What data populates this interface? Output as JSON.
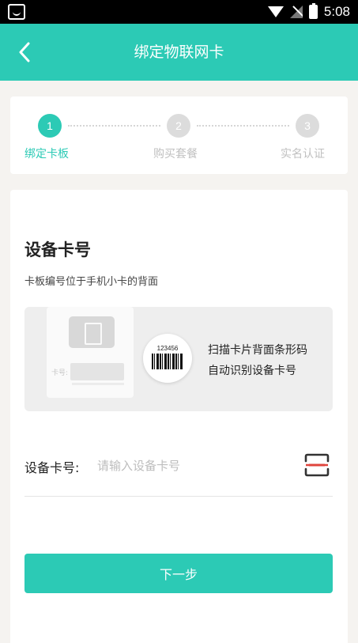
{
  "status_bar": {
    "time": "5:08"
  },
  "nav": {
    "title": "绑定物联网卡"
  },
  "steps": [
    {
      "number": "1",
      "label": "绑定卡板",
      "state": "active"
    },
    {
      "number": "2",
      "label": "购买套餐",
      "state": "inactive"
    },
    {
      "number": "3",
      "label": "实名认证",
      "state": "inactive"
    }
  ],
  "card_section": {
    "title": "设备卡号",
    "description": "卡板编号位于手机小卡的背面",
    "banner": {
      "sim_label": "卡号:",
      "barcode_number": "123456",
      "hint_line1": "扫描卡片背面条形码",
      "hint_line2": "自动识别设备卡号"
    },
    "input": {
      "label": "设备卡号:",
      "placeholder": "请输入设备卡号",
      "value": ""
    }
  },
  "next_button": {
    "label": "下一步"
  },
  "colors": {
    "accent": "#2ccab5",
    "inactive_step": "#dcdcdc",
    "scan_red": "#e0443c"
  },
  "icons": [
    "back-icon",
    "scan-icon",
    "wifi-icon",
    "signal-icon",
    "battery-icon"
  ]
}
